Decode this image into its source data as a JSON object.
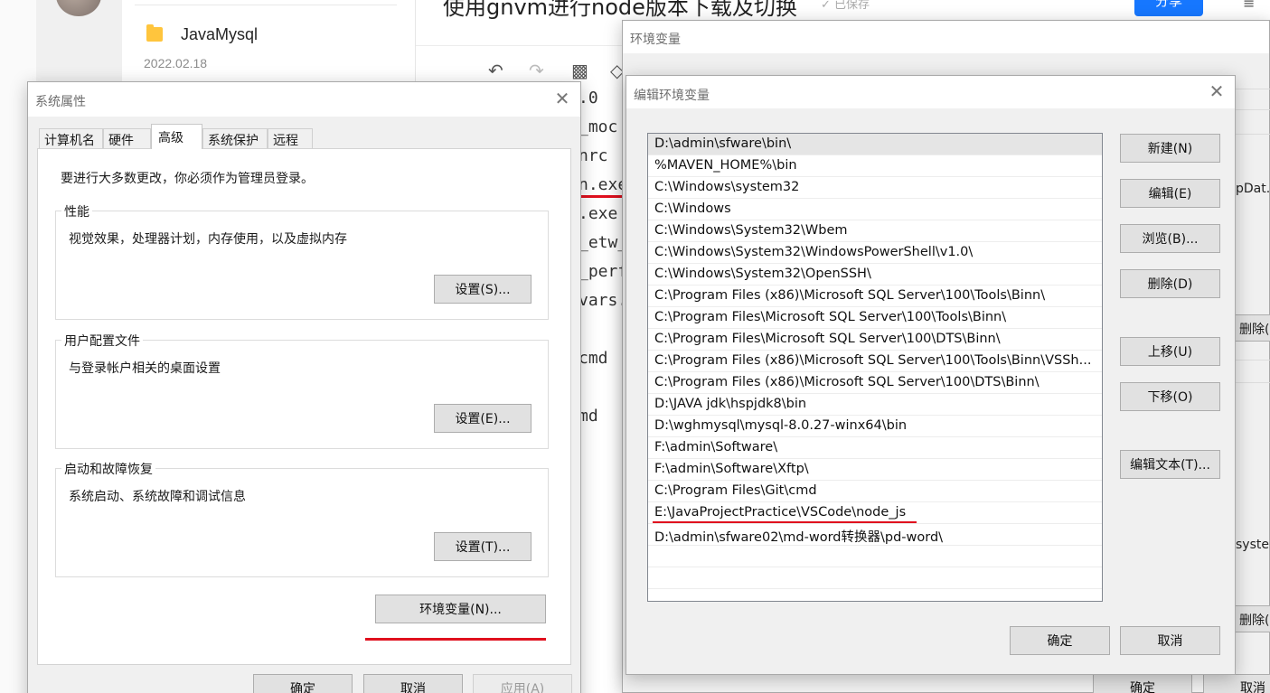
{
  "background_app": {
    "doc_list": {
      "folder_name": "JavaMysql",
      "folder_date": "2022.02.18"
    },
    "editor": {
      "title": "使用gnvm进行node版本下载及切换",
      "saved_status": "已保存",
      "share_label": "分享",
      "toolbar_icons": [
        "undo-icon",
        "redo-icon",
        "format-painter-icon",
        "eraser-icon"
      ],
      "code_lines": [
        ".0",
        "_moc",
        "nrc",
        "n.exe",
        ".exe",
        "_etw_",
        "_perf",
        "vars.b",
        "cmd",
        "md"
      ]
    }
  },
  "system_properties": {
    "title": "系统属性",
    "tabs": [
      {
        "label": "计算机名",
        "active": false
      },
      {
        "label": "硬件",
        "active": false
      },
      {
        "label": "高级",
        "active": true
      },
      {
        "label": "系统保护",
        "active": false
      },
      {
        "label": "远程",
        "active": false
      }
    ],
    "admin_note": "要进行大多数更改，你必须作为管理员登录。",
    "groups": [
      {
        "legend": "性能",
        "description": "视觉效果，处理器计划，内存使用，以及虚拟内存",
        "button": "设置(S)..."
      },
      {
        "legend": "用户配置文件",
        "description": "与登录帐户相关的桌面设置",
        "button": "设置(E)..."
      },
      {
        "legend": "启动和故障恢复",
        "description": "系统启动、系统故障和调试信息",
        "button": "设置(T)..."
      }
    ],
    "env_button": "环境变量(N)...",
    "ok_button": "确定",
    "cancel_button": "取消",
    "apply_button": "应用(A)"
  },
  "environment_variables": {
    "title": "环境变量",
    "side_texts": [
      "pDat.",
      "syste."
    ],
    "delete_buttons": [
      "删除(D",
      "删除(D"
    ],
    "ok_button": "确定",
    "cancel_button": "取消"
  },
  "edit_env": {
    "title": "编辑环境变量",
    "paths": [
      "D:\\admin\\sfware\\bin\\",
      "%MAVEN_HOME%\\bin",
      "C:\\Windows\\system32",
      "C:\\Windows",
      "C:\\Windows\\System32\\Wbem",
      "C:\\Windows\\System32\\WindowsPowerShell\\v1.0\\",
      "C:\\Windows\\System32\\OpenSSH\\",
      "C:\\Program Files (x86)\\Microsoft SQL Server\\100\\Tools\\Binn\\",
      "C:\\Program Files\\Microsoft SQL Server\\100\\Tools\\Binn\\",
      "C:\\Program Files\\Microsoft SQL Server\\100\\DTS\\Binn\\",
      "C:\\Program Files (x86)\\Microsoft SQL Server\\100\\Tools\\Binn\\VSSh...",
      "C:\\Program Files (x86)\\Microsoft SQL Server\\100\\DTS\\Binn\\",
      "D:\\JAVA jdk\\hspjdk8\\bin",
      "D:\\wghmysql\\mysql-8.0.27-winx64\\bin",
      "F:\\admin\\Software\\",
      "F:\\admin\\Software\\Xftp\\",
      "C:\\Program Files\\Git\\cmd",
      "E:\\JavaProjectPractice\\VSCode\\node_js",
      "D:\\admin\\sfware02\\md-word转换器\\pd-word\\"
    ],
    "buttons": {
      "new": "新建(N)",
      "edit": "编辑(E)",
      "browse": "浏览(B)...",
      "delete": "删除(D)",
      "move_up": "上移(U)",
      "move_down": "下移(O)",
      "edit_text": "编辑文本(T)...",
      "ok": "确定",
      "cancel": "取消"
    }
  },
  "colors": {
    "annotation_red": "#e0101e",
    "share_blue": "#1677ff",
    "folder_yellow": "#ffc53d"
  }
}
